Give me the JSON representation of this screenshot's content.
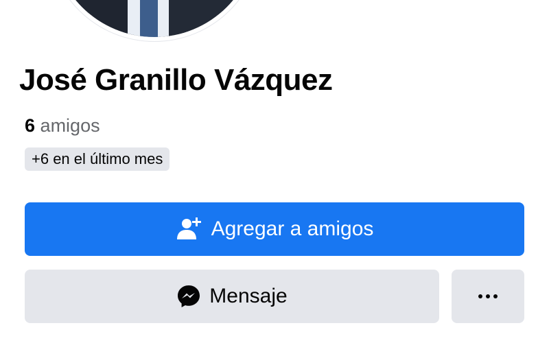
{
  "profile": {
    "name": "José Granillo Vázquez",
    "friends_count": "6",
    "friends_label": "amigos",
    "recent_badge": "+6 en el último mes"
  },
  "actions": {
    "add_friend_label": "Agregar a amigos",
    "message_label": "Mensaje"
  },
  "icons": {
    "add_friend": "add-friend-icon",
    "messenger": "messenger-icon",
    "more": "more-dots-icon"
  },
  "colors": {
    "primary": "#1877f2",
    "secondary_button": "#e4e6eb",
    "text": "#050505",
    "muted_text": "#65676b"
  }
}
